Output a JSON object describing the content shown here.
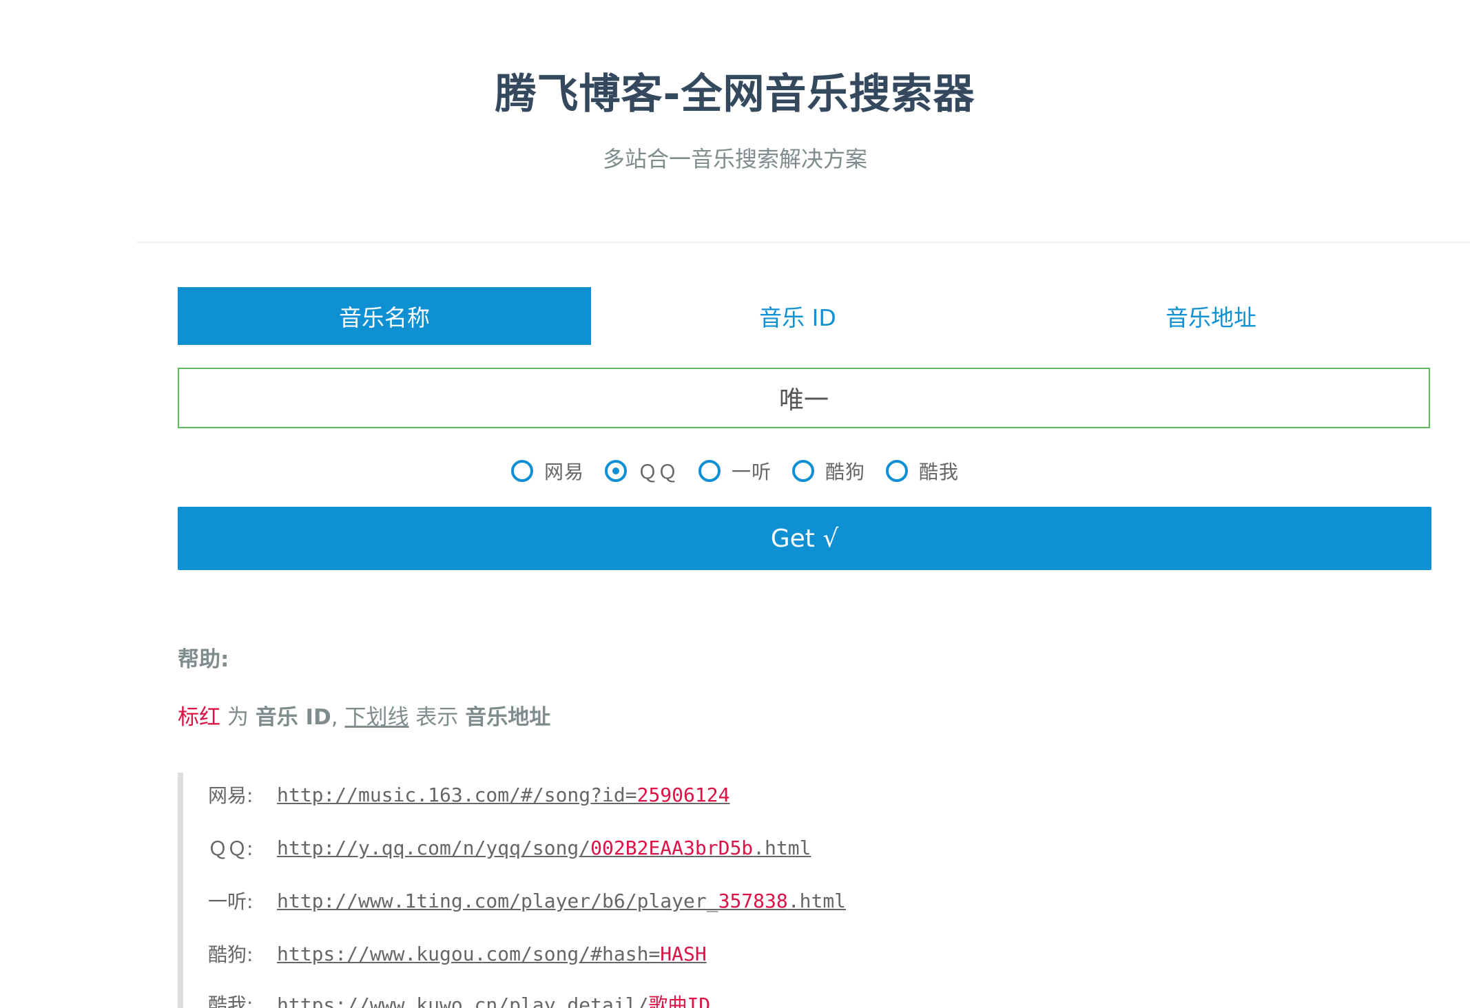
{
  "header": {
    "title": "腾飞博客-全网音乐搜索器",
    "subtitle": "多站合一音乐搜索解决方案"
  },
  "tabs": [
    {
      "label": "音乐名称",
      "active": true
    },
    {
      "label": "音乐 ID",
      "active": false
    },
    {
      "label": "音乐地址",
      "active": false
    }
  ],
  "search": {
    "value": "唯一",
    "placeholder": ""
  },
  "sources": [
    {
      "label": "网易",
      "checked": false
    },
    {
      "label": "ＱＱ",
      "checked": true
    },
    {
      "label": "一听",
      "checked": false
    },
    {
      "label": "酷狗",
      "checked": false
    },
    {
      "label": "酷我",
      "checked": false
    }
  ],
  "button": {
    "label": "Get √"
  },
  "help": {
    "title": "帮助:",
    "red_word": "标红",
    "text_wei": "为",
    "music_id": "音乐 ID",
    "comma": ",",
    "underline_word": "下划线",
    "text_biaoshi": "表示",
    "music_url": "音乐地址"
  },
  "examples": [
    {
      "label": "网易:",
      "prefix": "http://music.163.com/#/song?id=",
      "id": "25906124",
      "suffix": ""
    },
    {
      "label": "ＱＱ:",
      "prefix": "http://y.qq.com/n/yqq/song/",
      "id": "002B2EAA3brD5b",
      "suffix": ".html"
    },
    {
      "label": "一听:",
      "prefix": "http://www.1ting.com/player/b6/player_",
      "id": "357838",
      "suffix": ".html"
    },
    {
      "label": "酷狗:",
      "prefix": "https://www.kugou.com/song/#hash=",
      "id": "HASH",
      "suffix": ""
    },
    {
      "label": "酷我:",
      "prefix": "https://www.kuwo.cn/play_detail/",
      "id": "歌曲ID",
      "suffix": ""
    }
  ],
  "colors": {
    "primary": "#0e90d2",
    "title": "#34495e",
    "muted": "#7f8c8d",
    "highlight": "#dd1144",
    "input_border": "#5eb95e"
  }
}
